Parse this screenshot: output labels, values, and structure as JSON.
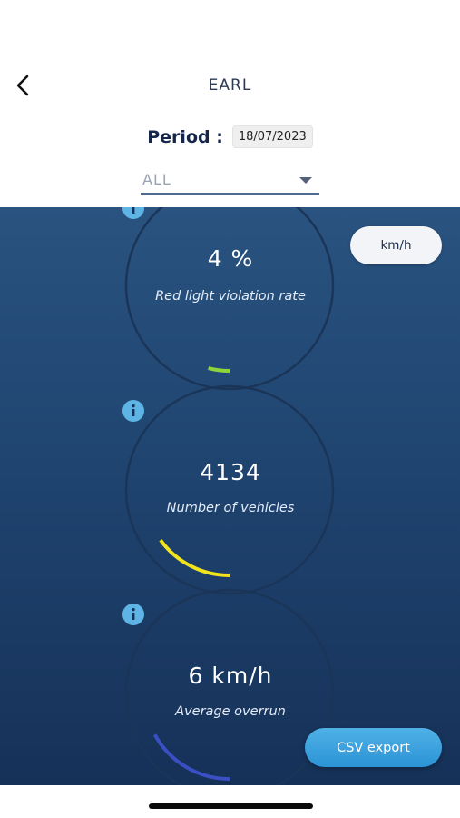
{
  "header": {
    "title": "EARL",
    "period_label": "Period :",
    "period_date": "18/07/2023",
    "filter_value": "ALL"
  },
  "unit_toggle": "km/h",
  "metrics": [
    {
      "value": "4 %",
      "label": "Red light violation rate",
      "progress": 0.04,
      "color": "#8ed43c"
    },
    {
      "value": "4134",
      "label": "Number of vehicles",
      "progress": 0.15,
      "color": "#f2e31e"
    },
    {
      "value": "6 km/h",
      "label": "Average overrun",
      "progress": 0.17,
      "color": "#3b4fc4"
    }
  ],
  "csv_export": "CSV export",
  "colors": {
    "panel_top": "#2a5380",
    "panel_bottom": "#163158",
    "info": "#5fb4e6",
    "csv": "#2b93d6"
  },
  "icons": [
    "chevron-left-icon",
    "dropdown-arrow-icon",
    "info-icon"
  ]
}
